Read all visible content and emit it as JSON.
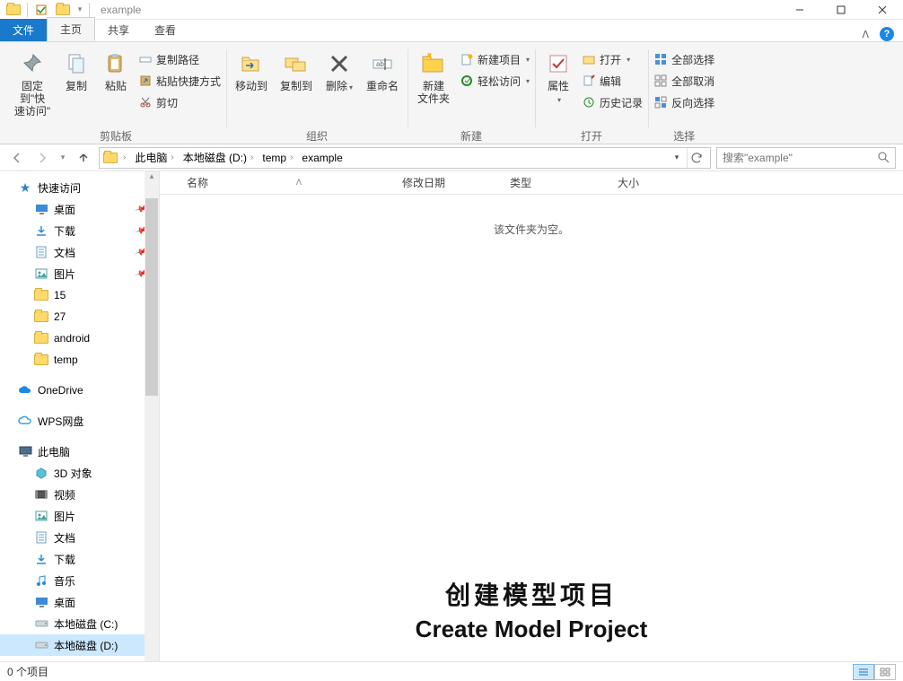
{
  "titlebar": {
    "title": "example"
  },
  "window_controls": {
    "min": "—",
    "max": "☐",
    "close": "✕"
  },
  "tabs": {
    "file": "文件",
    "home": "主页",
    "share": "共享",
    "view": "查看"
  },
  "ribbon": {
    "clipboard": {
      "pin": "固定到\"快\n速访问\"",
      "copy": "复制",
      "paste": "粘贴",
      "copy_path": "复制路径",
      "paste_shortcut": "粘贴快捷方式",
      "cut": "剪切",
      "group": "剪贴板"
    },
    "organize": {
      "move_to": "移动到",
      "copy_to": "复制到",
      "delete": "删除",
      "rename": "重命名",
      "group": "组织"
    },
    "new": {
      "new_folder": "新建\n文件夹",
      "new_item": "新建项目",
      "easy_access": "轻松访问",
      "group": "新建"
    },
    "open": {
      "properties": "属性",
      "open": "打开",
      "edit": "编辑",
      "history": "历史记录",
      "group": "打开"
    },
    "select": {
      "select_all": "全部选择",
      "select_none": "全部取消",
      "invert": "反向选择",
      "group": "选择"
    }
  },
  "breadcrumbs": [
    "此电脑",
    "本地磁盘 (D:)",
    "temp",
    "example"
  ],
  "search": {
    "placeholder": "搜索\"example\""
  },
  "columns": {
    "name": "名称",
    "modified": "修改日期",
    "type": "类型",
    "size": "大小"
  },
  "empty": "该文件夹为空。",
  "sidebar": {
    "quick_access": "快速访问",
    "quick_items": [
      {
        "label": "桌面",
        "icon": "desktop",
        "pinned": true
      },
      {
        "label": "下载",
        "icon": "download",
        "pinned": true
      },
      {
        "label": "文档",
        "icon": "doc",
        "pinned": true
      },
      {
        "label": "图片",
        "icon": "pic",
        "pinned": true
      },
      {
        "label": "15",
        "icon": "folder",
        "pinned": false
      },
      {
        "label": "27",
        "icon": "folder",
        "pinned": false
      },
      {
        "label": "android",
        "icon": "folder",
        "pinned": false
      },
      {
        "label": "temp",
        "icon": "folder",
        "pinned": false
      }
    ],
    "onedrive": "OneDrive",
    "wps": "WPS网盘",
    "this_pc": "此电脑",
    "pc_items": [
      {
        "label": "3D 对象",
        "icon": "3d"
      },
      {
        "label": "视频",
        "icon": "video"
      },
      {
        "label": "图片",
        "icon": "pic"
      },
      {
        "label": "文档",
        "icon": "doc"
      },
      {
        "label": "下载",
        "icon": "download"
      },
      {
        "label": "音乐",
        "icon": "music"
      },
      {
        "label": "桌面",
        "icon": "desktop"
      },
      {
        "label": "本地磁盘 (C:)",
        "icon": "drive"
      },
      {
        "label": "本地磁盘 (D:)",
        "icon": "drive",
        "selected": true
      }
    ]
  },
  "status": {
    "items": "0 个项目"
  },
  "overlay": {
    "l1": "创建模型项目",
    "l2": "Create Model Project"
  }
}
